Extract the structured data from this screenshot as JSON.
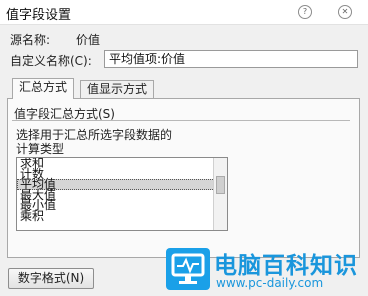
{
  "window": {
    "title": "值字段设置"
  },
  "source": {
    "label": "源名称:",
    "value": "价值"
  },
  "custom_name": {
    "label": "自定义名称(C):",
    "value": "平均值项:价值"
  },
  "tabs": [
    {
      "label": "汇总方式",
      "active": true
    },
    {
      "label": "值显示方式",
      "active": false
    }
  ],
  "summary": {
    "group_label": "值字段汇总方式(S)",
    "description_line1": "选择用于汇总所选字段数据的",
    "description_line2": "计算类型",
    "options": [
      "求和",
      "计数",
      "平均值",
      "最大值",
      "最小值",
      "乘积"
    ],
    "selected": "平均值"
  },
  "buttons": {
    "number_format": "数字格式(N)"
  },
  "watermark": {
    "name": "电脑百科知识",
    "url": "www.pc-daily.com"
  },
  "colors": {
    "watermark": "#1a96dc",
    "selection": "#d6d6d6"
  }
}
